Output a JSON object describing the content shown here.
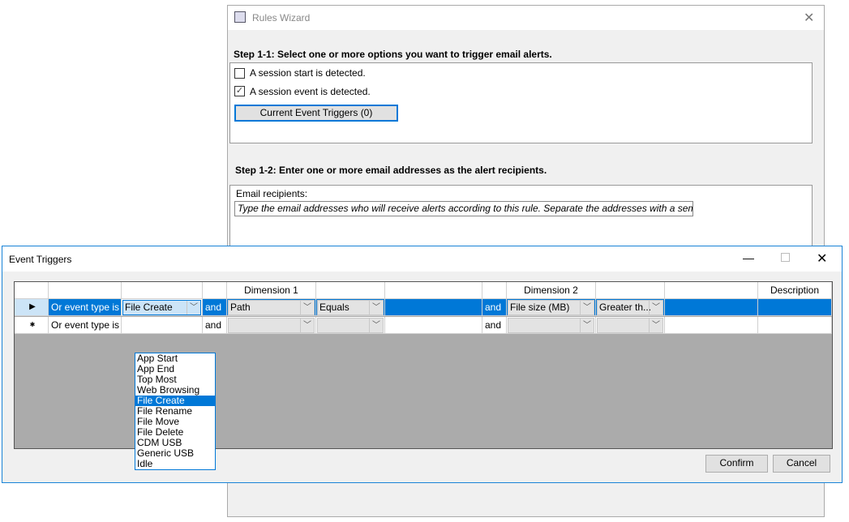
{
  "wizard": {
    "title": "Rules Wizard",
    "close_icon": "close-icon",
    "step1_heading": "Step 1-1: Select one or more options you want to trigger email alerts.",
    "options": [
      {
        "label": "A session start is detected.",
        "checked": false
      },
      {
        "label": "A session event is detected.",
        "checked": true
      }
    ],
    "current_triggers_button": "Current Event Triggers (0)",
    "step2_heading": "Step 1-2: Enter one or more email addresses as the alert recipients.",
    "email_label": "Email recipients:",
    "email_placeholder": "Type the email addresses who will receive alerts according to this rule. Separate the addresses with a semicolon (;)."
  },
  "event_triggers": {
    "title": "Event Triggers",
    "columns": [
      "",
      "",
      "",
      "Dimension 1",
      "",
      "",
      "Dimension 2",
      "",
      "",
      "Description"
    ],
    "rows": [
      {
        "prefix": "Or event type is",
        "event": "File Create",
        "and1": "and",
        "dim1": "Path",
        "op1": "Equals",
        "value1": "",
        "and2": "and",
        "dim2": "File size (MB)",
        "op2": "Greater th...",
        "value2": "",
        "description": ""
      },
      {
        "prefix": "Or event type is",
        "event": "",
        "and1": "and",
        "dim1": "",
        "op1": "",
        "value1": "",
        "and2": "and",
        "dim2": "",
        "op2": "",
        "value2": "",
        "description": ""
      }
    ],
    "dropdown_options": [
      "App Start",
      "App End",
      "Top Most",
      "Web Browsing",
      "File Create",
      "File Rename",
      "File Move",
      "File Delete",
      "CDM USB",
      "Generic USB",
      "Idle"
    ],
    "dropdown_selected": "File Create",
    "confirm": "Confirm",
    "cancel": "Cancel"
  }
}
